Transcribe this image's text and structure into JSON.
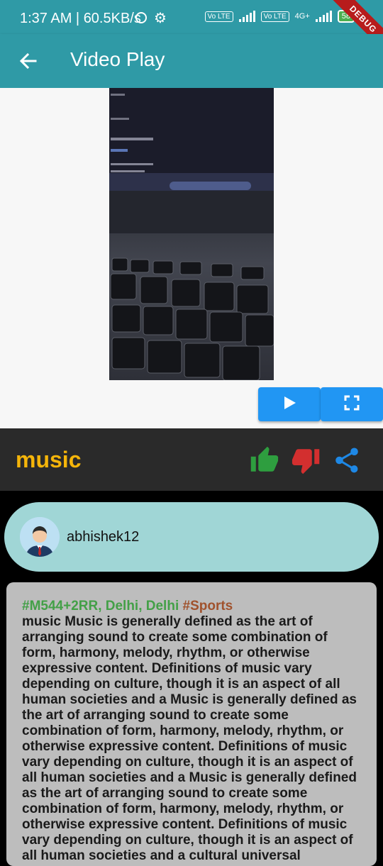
{
  "status_bar": {
    "text": "1:37 AM | 60.5KB/s",
    "volte1": "Vo LTE",
    "volte2": "Vo LTE",
    "network": "4G+",
    "battery": "58",
    "debug_label": "DEBUG"
  },
  "app_bar": {
    "title": "Video Play"
  },
  "video": {
    "title": "music"
  },
  "user": {
    "username": "abhishek12"
  },
  "post": {
    "location": "#M544+2RR, Delhi, Delhi",
    "tag": "#Sports",
    "description": "music Music is generally defined as the art of arranging sound to create some combination of form, harmony, melody, rhythm, or otherwise expressive content. Definitions of music vary depending on culture, though it is an aspect of all human societies and a Music is generally defined as the art of arranging sound to create some combination of form, harmony, melody, rhythm, or otherwise expressive content. Definitions of music vary depending on culture, though it is an aspect of all human societies and a Music is generally defined as the art of arranging sound to create some combination of form, harmony, melody, rhythm, or otherwise expressive content. Definitions of music vary depending on culture, though it is an aspect of all human societies and a cultural universal"
  },
  "icons": {
    "back": "arrow-back-icon",
    "play": "play-icon",
    "fullscreen": "fullscreen-icon",
    "like": "thumbs-up-icon",
    "dislike": "thumbs-down-icon",
    "share": "share-icon"
  },
  "colors": {
    "app_bar": "#2f9aa6",
    "title": "#f5b50a",
    "like": "#2e9e3f",
    "dislike": "#d32f2f",
    "share": "#1e88e5",
    "button": "#2196f3",
    "location": "#43a047",
    "tag": "#a0522d"
  }
}
